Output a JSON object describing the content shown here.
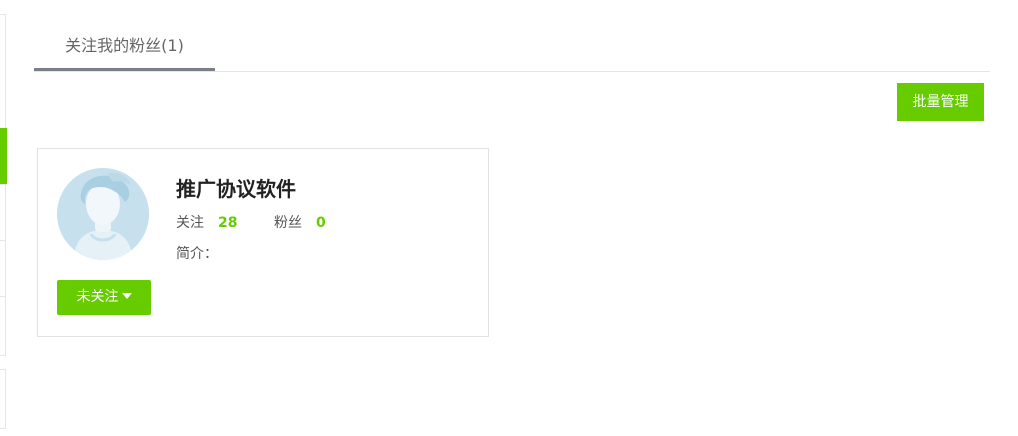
{
  "tabs": [
    {
      "label": "关注我的粉丝(1)",
      "active": true
    }
  ],
  "toolbar": {
    "batch_manage_label": "批量管理"
  },
  "fans": [
    {
      "name": "推广协议软件",
      "following_label": "关注",
      "following_count": "28",
      "followers_label": "粉丝",
      "followers_count": "0",
      "bio_label": "简介：",
      "bio": "",
      "follow_button_label": "未关注",
      "avatar_icon": "default-user-avatar"
    }
  ],
  "colors": {
    "accent": "#66cc00",
    "tab_underline": "#7a7f87",
    "border": "#e2e2e2"
  }
}
